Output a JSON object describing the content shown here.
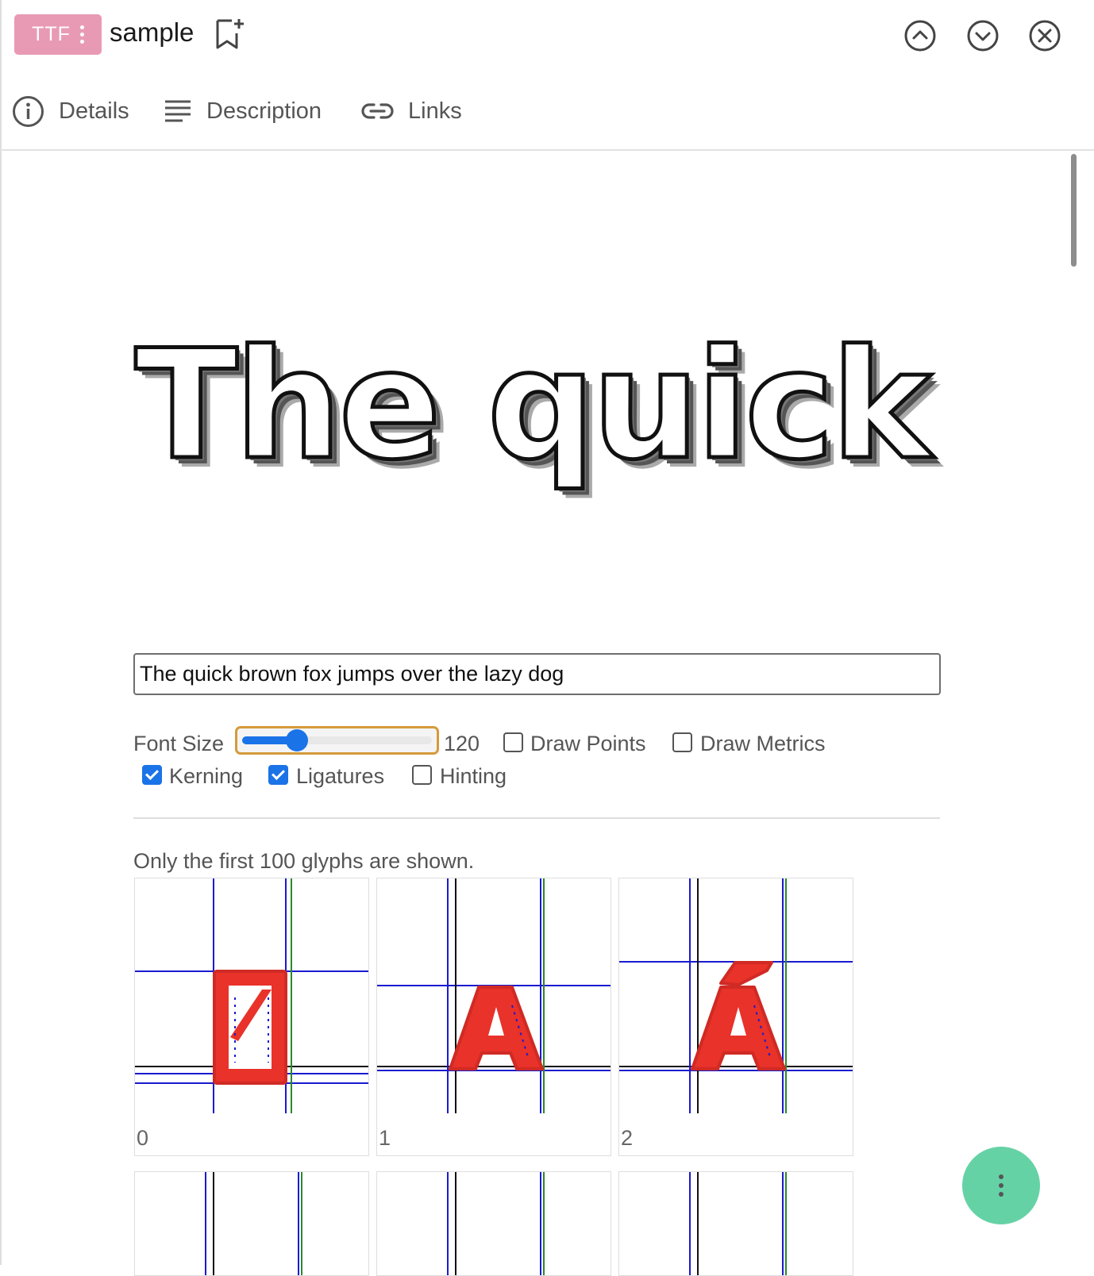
{
  "header": {
    "badge": "TTF",
    "title": "sample",
    "icons": [
      "bookmark-add-icon",
      "chevron-up-circle-icon",
      "chevron-down-circle-icon",
      "close-circle-icon"
    ]
  },
  "tabs": [
    {
      "label": "Details",
      "icon": "info-icon"
    },
    {
      "label": "Description",
      "icon": "lines-icon"
    },
    {
      "label": "Links",
      "icon": "link-icon"
    }
  ],
  "preview": {
    "text": "The quick"
  },
  "controls": {
    "sample_text": "The quick brown fox jumps over the lazy dog",
    "font_size_label": "Font Size",
    "font_size_value": "120",
    "font_size_fraction": 0.26,
    "draw_points_label": "Draw Points",
    "draw_points": false,
    "draw_metrics_label": "Draw Metrics",
    "draw_metrics": false,
    "kerning_label": "Kerning",
    "kerning": true,
    "ligatures_label": "Ligatures",
    "ligatures": true,
    "hinting_label": "Hinting",
    "hinting": false
  },
  "glyphs": {
    "note": "Only the first 100 glyphs are shown.",
    "items": [
      {
        "index": "0",
        "glyph": "notdef"
      },
      {
        "index": "1",
        "glyph": "A"
      },
      {
        "index": "2",
        "glyph": "Á"
      }
    ]
  },
  "colors": {
    "badge": "#e89ab4",
    "accent": "#1b73e8",
    "slider_focus": "#d49a3a",
    "glyph_fill": "#e8322a",
    "metric_blue": "#1a1ad0",
    "advance_green": "#2a8a2a",
    "fab": "#65d2a6"
  }
}
